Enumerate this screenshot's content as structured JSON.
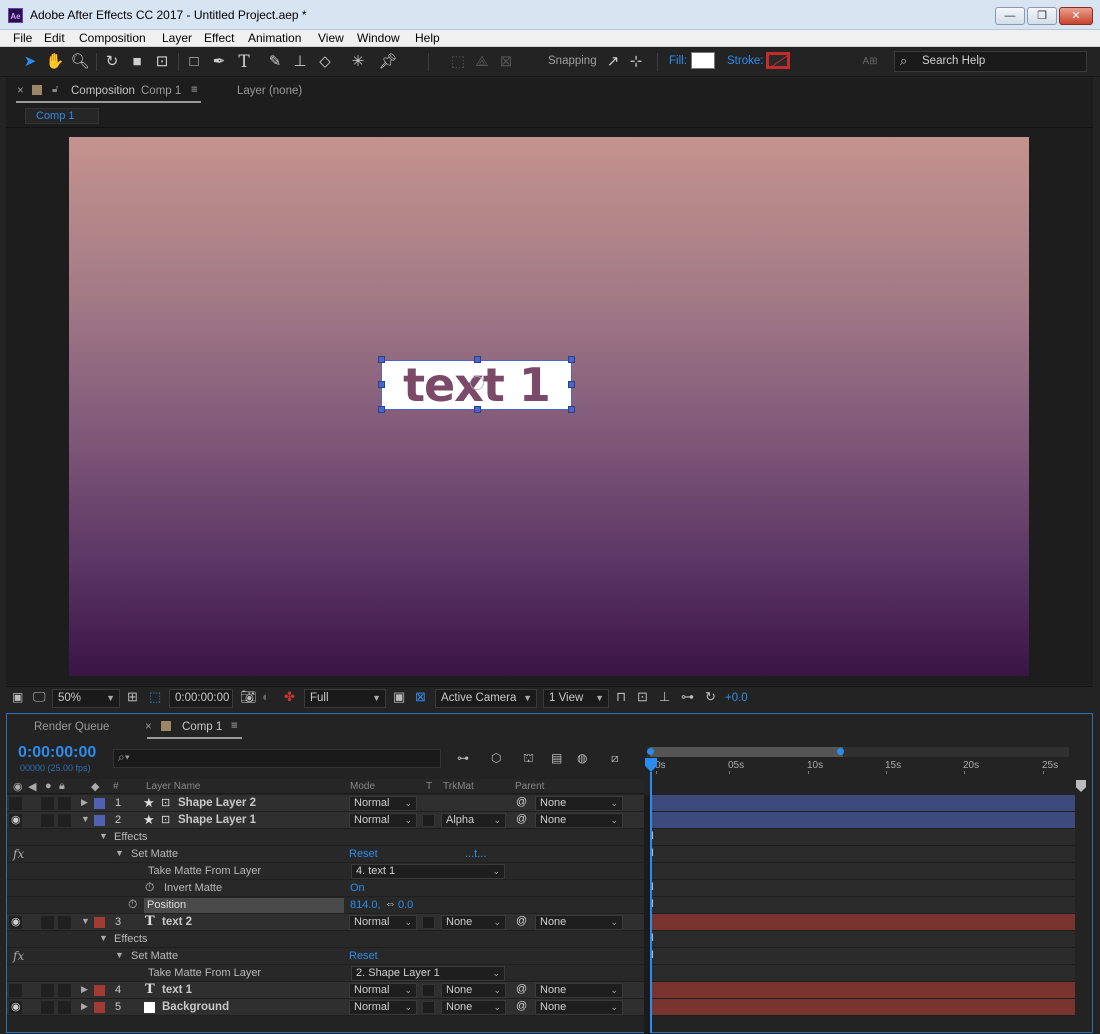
{
  "window": {
    "title": "Adobe After Effects CC 2017 - Untitled Project.aep *",
    "logo": "Ae",
    "minimize": "—",
    "maximize": "❐",
    "close": "✕"
  },
  "menu": [
    "File",
    "Edit",
    "Composition",
    "Layer",
    "Effect",
    "Animation",
    "View",
    "Window",
    "Help"
  ],
  "toolbar": {
    "snapping": "Snapping",
    "fill": "Fill:",
    "stroke": "Stroke:",
    "search_placeholder": "Search Help",
    "colors": {
      "fill": "#ffffff",
      "stroke": "#c42b2b",
      "accent": "#2d8ceb"
    }
  },
  "comp_panel": {
    "tab_close": "×",
    "tab_prefix": "Composition",
    "tab_name": "Comp 1",
    "tab_menu": "≡",
    "layer_tab": "Layer (none)",
    "breadcrumb": "Comp 1"
  },
  "canvas": {
    "text": "text 1"
  },
  "viewer": {
    "zoom": "50%",
    "timecode": "0:00:00:00",
    "resolution": "Full",
    "camera": "Active Camera",
    "views": "1 View",
    "exposure": "+0.0"
  },
  "timeline": {
    "render_queue": "Render Queue",
    "tab_close": "×",
    "tab": "Comp 1",
    "tab_menu": "≡",
    "timecode": "0:00:00:00",
    "frames": "00000 (25.00 fps)",
    "search_icon": "⌕▾",
    "headers": {
      "num": "#",
      "name": "Layer Name",
      "mode": "Mode",
      "t": "T",
      "trkmat": "TrkMat",
      "parent": "Parent"
    },
    "ruler": [
      "0s",
      "05s",
      "10s",
      "15s",
      "20s",
      "25s"
    ],
    "rows": [
      {
        "kind": "layer",
        "num": "1",
        "name": "Shape Layer 2",
        "mode": "Normal",
        "trkmat": "",
        "parent": "None",
        "color": "#5061b3",
        "expanded": false,
        "eye": false
      },
      {
        "kind": "layer",
        "num": "2",
        "name": "Shape Layer 1",
        "mode": "Normal",
        "trkmat": "Alpha",
        "parent": "None",
        "color": "#5061b3",
        "expanded": true,
        "eye": true
      },
      {
        "kind": "group",
        "label": "Effects"
      },
      {
        "kind": "effect",
        "label": "Set Matte",
        "reset": "Reset",
        "extra": "...t..."
      },
      {
        "kind": "prop",
        "label": "Take Matte From Layer",
        "value": "4. text 1"
      },
      {
        "kind": "prop2",
        "label": "Invert Matte",
        "value": "On"
      },
      {
        "kind": "prop3",
        "label": "Position",
        "value": "814.0,",
        "value2": "0.0"
      },
      {
        "kind": "layer",
        "num": "3",
        "name": "text 2",
        "mode": "Normal",
        "trkmat": "None",
        "parent": "None",
        "color": "#a33b35",
        "expanded": true,
        "eye": true
      },
      {
        "kind": "group",
        "label": "Effects"
      },
      {
        "kind": "effect",
        "label": "Set Matte",
        "reset": "Reset",
        "extra": ""
      },
      {
        "kind": "prop",
        "label": "Take Matte From Layer",
        "value": "2. Shape Layer 1"
      },
      {
        "kind": "layer",
        "num": "4",
        "name": "text 1",
        "mode": "Normal",
        "trkmat": "None",
        "parent": "None",
        "color": "#a33b35",
        "expanded": false,
        "eye": false
      },
      {
        "kind": "layer",
        "num": "5",
        "name": "Background",
        "mode": "Normal",
        "trkmat": "None",
        "parent": "None",
        "color": "#a33b35",
        "expanded": false,
        "eye": true
      }
    ]
  }
}
